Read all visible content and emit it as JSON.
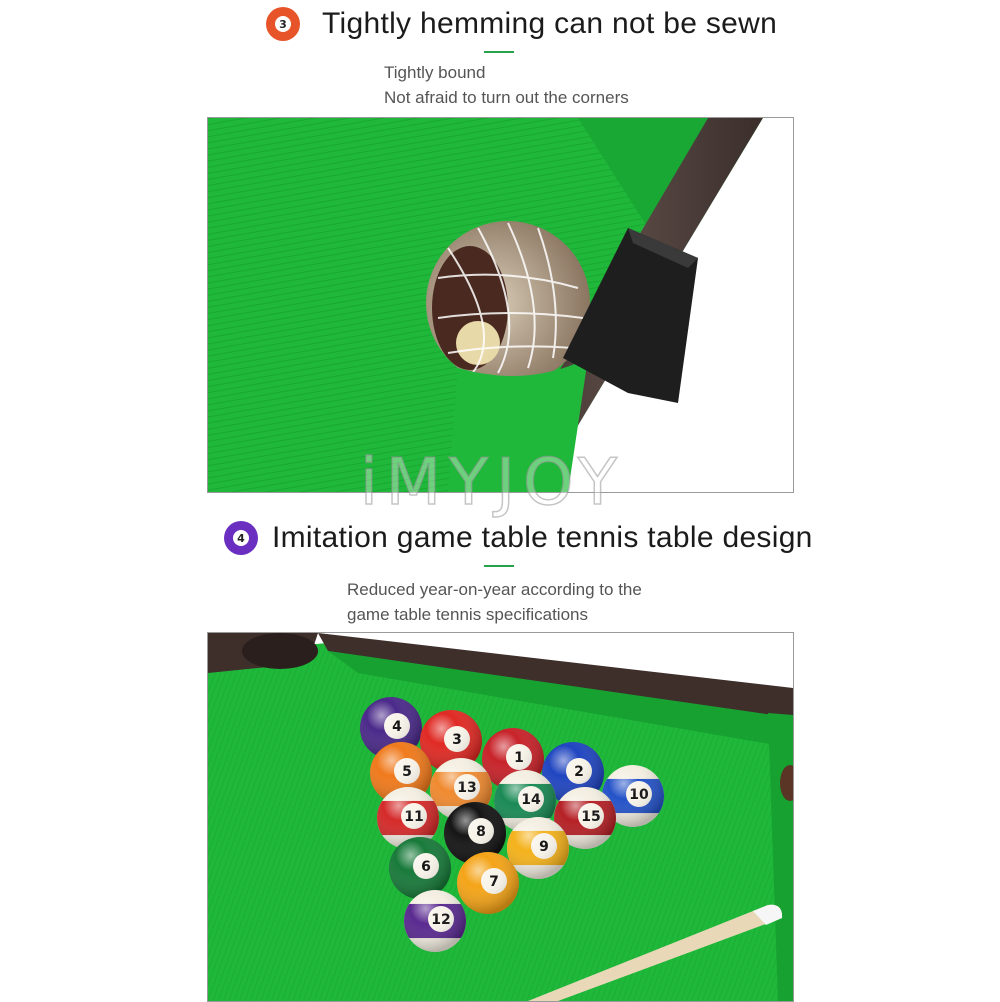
{
  "section3": {
    "number": "3",
    "badge_color": "#e8542a",
    "title": "Tightly hemming can not be sewn",
    "desc_line1": "Tightly bound",
    "desc_line2": "Not afraid to turn out the corners"
  },
  "section4": {
    "number": "4",
    "badge_color": "#6a2fc1",
    "title": "Imitation game table tennis table design",
    "desc_line1": "Reduced year-on-year according to the",
    "desc_line2": "game table tennis specifications"
  },
  "watermark": "iMYJOY",
  "colors": {
    "felt": "#1fb83a",
    "accent": "#27a14a",
    "rail": "#4a3a36"
  },
  "balls": [
    {
      "number": "4",
      "color": "#4b2a8a",
      "stripe": false
    },
    {
      "number": "3",
      "color": "#e02a24",
      "stripe": false
    },
    {
      "number": "1",
      "color": "#c8232a",
      "stripe": false
    },
    {
      "number": "2",
      "color": "#2045c0",
      "stripe": false
    },
    {
      "number": "10",
      "color": "#2553c8",
      "stripe": true
    },
    {
      "number": "5",
      "color": "#f07a1c",
      "stripe": false
    },
    {
      "number": "13",
      "color": "#f08a30",
      "stripe": true
    },
    {
      "number": "14",
      "color": "#1a8a55",
      "stripe": true
    },
    {
      "number": "15",
      "color": "#b52126",
      "stripe": true
    },
    {
      "number": "11",
      "color": "#d52a2a",
      "stripe": true
    },
    {
      "number": "8",
      "color": "#151515",
      "stripe": false
    },
    {
      "number": "9",
      "color": "#f4b21c",
      "stripe": true
    },
    {
      "number": "6",
      "color": "#187a3a",
      "stripe": false
    },
    {
      "number": "7",
      "color": "#f4a418",
      "stripe": false
    },
    {
      "number": "12",
      "color": "#5a2a90",
      "stripe": true
    }
  ]
}
